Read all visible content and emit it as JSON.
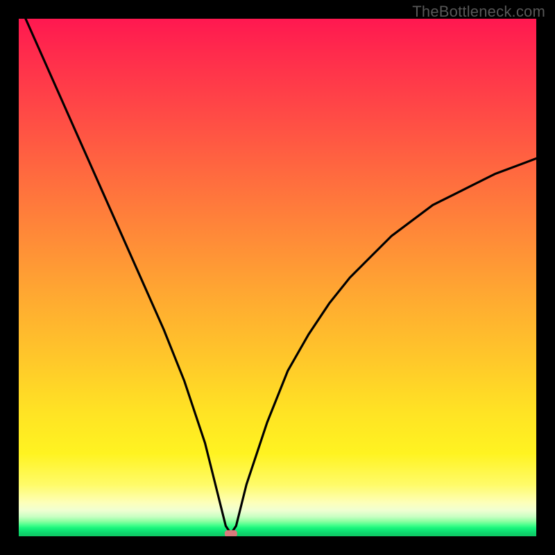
{
  "watermark": "TheBottleneck.com",
  "chart_data": {
    "type": "line",
    "title": "",
    "xlabel": "",
    "ylabel": "",
    "xlim": [
      0,
      100
    ],
    "ylim": [
      0,
      100
    ],
    "grid": false,
    "legend": false,
    "gradient_colors": {
      "top": "#ff1850",
      "mid": "#ffe324",
      "bottom": "#0fc964"
    },
    "series": [
      {
        "name": "bottleneck-curve",
        "x": [
          0,
          4,
          8,
          12,
          16,
          20,
          24,
          28,
          32,
          36,
          38,
          40,
          41,
          42,
          44,
          48,
          52,
          56,
          60,
          64,
          68,
          72,
          76,
          80,
          84,
          88,
          92,
          96,
          100
        ],
        "y": [
          103,
          94,
          85,
          76,
          67,
          58,
          49,
          40,
          30,
          18,
          10,
          2,
          0.5,
          2,
          10,
          22,
          32,
          39,
          45,
          50,
          54,
          58,
          61,
          64,
          66,
          68,
          70,
          71.5,
          73
        ]
      }
    ],
    "marker": {
      "name": "minimum-point",
      "x": 41,
      "y": 0.5,
      "color": "#d97a7d",
      "shape": "rounded-rect",
      "size": 0.9
    }
  }
}
